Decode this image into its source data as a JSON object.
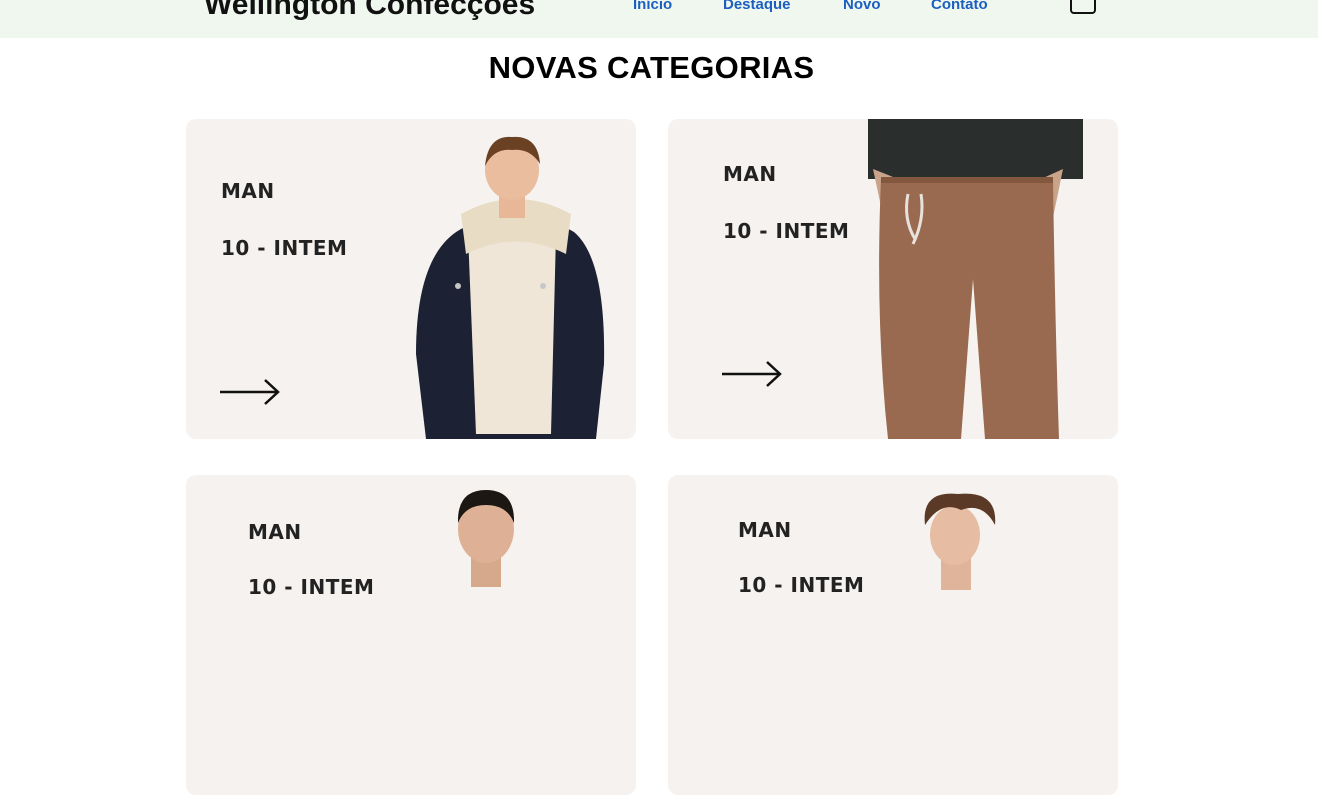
{
  "header": {
    "brand": "Wellington Confecções",
    "nav": [
      "Início",
      "Destaque",
      "Novo",
      "Contato"
    ]
  },
  "section_title": "NOVAS CATEGORIAS",
  "cards": [
    {
      "label": "MAN",
      "count": "10 - INTEM"
    },
    {
      "label": "MAN",
      "count": "10 - INTEM"
    },
    {
      "label": "MAN",
      "count": "10 - INTEM"
    },
    {
      "label": "MAN",
      "count": "10 - INTEM"
    }
  ],
  "colors": {
    "header_bg": "#f0f7ef",
    "nav_link": "#1b5fbf",
    "card_bg": "#f6f2ef"
  }
}
